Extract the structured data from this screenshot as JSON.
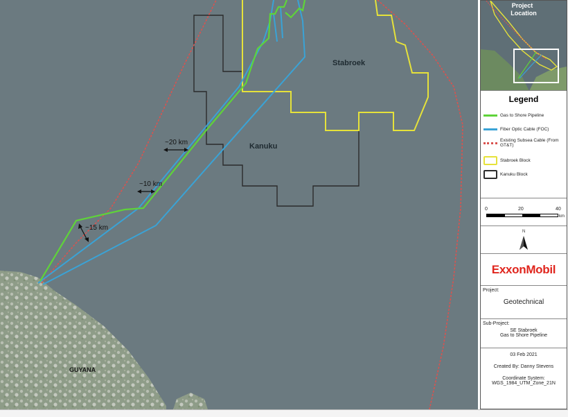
{
  "map": {
    "labels": {
      "stabroek": "Stabroek",
      "kanuku": "Kanuku",
      "guyana": "GUYANA",
      "dist_20": "~20 km",
      "dist_10": "~10 km",
      "dist_15": "~15 km"
    },
    "colors": {
      "sea": "#6b7a80",
      "pipeline": "#5fd33a",
      "foc": "#3aa3d6",
      "subsea": "#d9534f",
      "stabroek": "#e6e23a",
      "kanuku": "#2b2b2b"
    }
  },
  "inset": {
    "title_line1": "Project",
    "title_line2": "Location"
  },
  "legend": {
    "title": "Legend",
    "items": [
      {
        "label": "Gas to Shore Pipeline",
        "icon": "green-line"
      },
      {
        "label": "Fiber Optic Cable (FOC)",
        "icon": "blue-line"
      },
      {
        "label": "Existing Subsea Cable (From GT&T)",
        "icon": "red-dashed-line"
      },
      {
        "label": "Stabroek Block",
        "icon": "yellow-box"
      },
      {
        "label": "Kanuku Block",
        "icon": "black-box"
      }
    ]
  },
  "scale": {
    "ticks": [
      "0",
      "20",
      "40"
    ],
    "unit": "km"
  },
  "north": {
    "label": "N"
  },
  "logo": {
    "text": "ExxonMobil",
    "color": "#e0261e"
  },
  "project": {
    "label": "Project:",
    "value": "Geotechnical"
  },
  "subproject": {
    "label": "Sub-Project:",
    "line1": "SE Stabroek",
    "line2": "Gas to Shore Pipeline"
  },
  "meta": {
    "date": "03 Feb 2021",
    "created_by": "Created By: Danny Stevens",
    "coord_label": "Coordinate System:",
    "coord_value": "WGS_1984_UTM_Zone_21N"
  }
}
